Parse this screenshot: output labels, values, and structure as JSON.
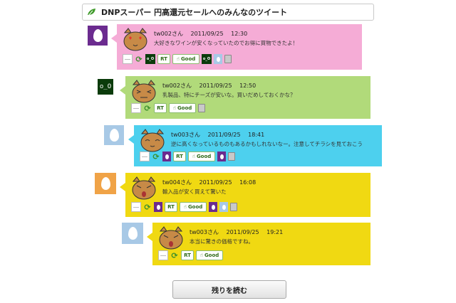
{
  "header": {
    "title": "DNPスーパー 円高還元セールへのみんなのツイート"
  },
  "tweets": [
    {
      "user": "tw002さん",
      "date": "2011/09/25",
      "time": "12:30",
      "text": "大好きなワインが安くなっていたのでお得に買物できたよ！",
      "bubble_color": "#f5acd6",
      "avatar": "egg-purple",
      "cat_mood": "heart-eyes",
      "actions": [
        "reply",
        "retweet",
        "thumbnail-oo",
        "RT",
        "Good",
        "thumbnail-oo",
        "egg-blue",
        "trash"
      ],
      "action_thumb_label": "o_O"
    },
    {
      "user": "tw002さん",
      "date": "2011/09/25",
      "time": "12:50",
      "text": "乳製品、特にチーズが安いな。買いだめしておくかな？",
      "bubble_color": "#b1da7a",
      "avatar": "oo",
      "avatar_label": "o_O",
      "cat_mood": "squint",
      "actions": [
        "reply",
        "retweet",
        "RT",
        "Good",
        "trash"
      ]
    },
    {
      "user": "tw003さん",
      "date": "2011/09/25",
      "time": "18:41",
      "text": "逆に高くなっているものもあるかもしれないなー。注意してチラシを見ておこう",
      "bubble_color": "#4dd0ee",
      "avatar": "egg-blue",
      "cat_mood": "sleepy",
      "actions": [
        "reply",
        "retweet",
        "egg-purple",
        "RT",
        "Good",
        "egg-purple",
        "trash"
      ]
    },
    {
      "user": "tw004さん",
      "date": "2011/09/25",
      "time": "16:08",
      "text": "輸入品が安く買えて驚いた",
      "bubble_color": "#f0d912",
      "avatar": "egg-orange",
      "cat_mood": "shocked",
      "actions": [
        "reply",
        "retweet",
        "egg-purple",
        "RT",
        "Good",
        "egg-purple",
        "egg-blue",
        "trash"
      ]
    },
    {
      "user": "tw003さん",
      "date": "2011/09/25",
      "time": "19:21",
      "text": "本当に驚きの価格ですね。",
      "bubble_color": "#f0d912",
      "avatar": "egg-blue",
      "cat_mood": "shocked",
      "actions": [
        "reply",
        "retweet",
        "RT",
        "Good"
      ]
    }
  ],
  "labels": {
    "rt": "RT",
    "good": "Good"
  },
  "more_button": {
    "label": "残りを読む"
  }
}
